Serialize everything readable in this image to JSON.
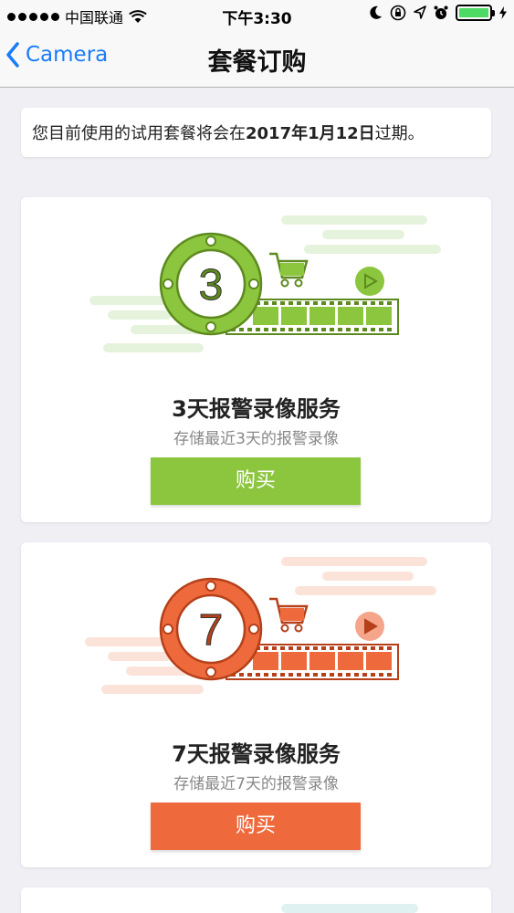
{
  "status_bar": {
    "carrier": "中国联通",
    "time": "下午3:30"
  },
  "nav": {
    "back_label": "Camera",
    "title": "套餐订购"
  },
  "notice": {
    "prefix": "您目前使用的试用套餐将会在",
    "date": "2017年1月12日",
    "suffix": "过期。"
  },
  "plans": [
    {
      "days_badge": "3",
      "title": "3天报警录像服务",
      "subtitle": "存储最近3天的报警录像",
      "buy_label": "购买",
      "accent": "#8cc63f",
      "accent_dark": "#5d8a1e",
      "cloud": "#e6f3dc"
    },
    {
      "days_badge": "7",
      "title": "7天报警录像服务",
      "subtitle": "存储最近7天的报警录像",
      "buy_label": "购买",
      "accent": "#ee6a3c",
      "accent_dark": "#b5401a",
      "cloud": "#fbe3da"
    }
  ]
}
